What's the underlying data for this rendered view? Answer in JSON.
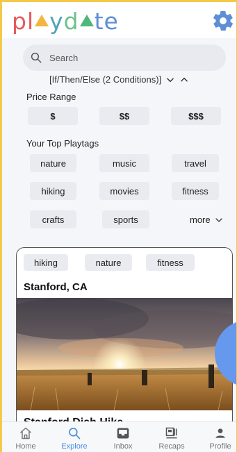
{
  "header": {
    "logo_text": "playdate",
    "logo_letters": [
      "pl",
      "y",
      "d",
      "te"
    ]
  },
  "search": {
    "placeholder": "Search"
  },
  "condition": {
    "label": "[If/Then/Else (2 Conditions)]"
  },
  "price_range": {
    "title": "Price Range",
    "options": [
      "$",
      "$$",
      "$$$"
    ]
  },
  "playtags": {
    "title": "Your Top Playtags",
    "tags": [
      "nature",
      "music",
      "travel",
      "hiking",
      "movies",
      "fitness",
      "crafts",
      "sports"
    ],
    "more_label": "more"
  },
  "card": {
    "tags": [
      "hiking",
      "nature",
      "fitness"
    ],
    "location": "Stanford, CA",
    "title": "Stanford Dish Hike"
  },
  "nav": {
    "items": [
      {
        "label": "Home",
        "icon": "home-icon"
      },
      {
        "label": "Explore",
        "icon": "search-icon"
      },
      {
        "label": "Inbox",
        "icon": "inbox-icon"
      },
      {
        "label": "Recaps",
        "icon": "recaps-icon"
      },
      {
        "label": "Profile",
        "icon": "profile-icon"
      }
    ],
    "active": "Explore"
  },
  "colors": {
    "accent": "#4a8ee0",
    "fab": "#6699ee",
    "border": "#f3c94a"
  }
}
